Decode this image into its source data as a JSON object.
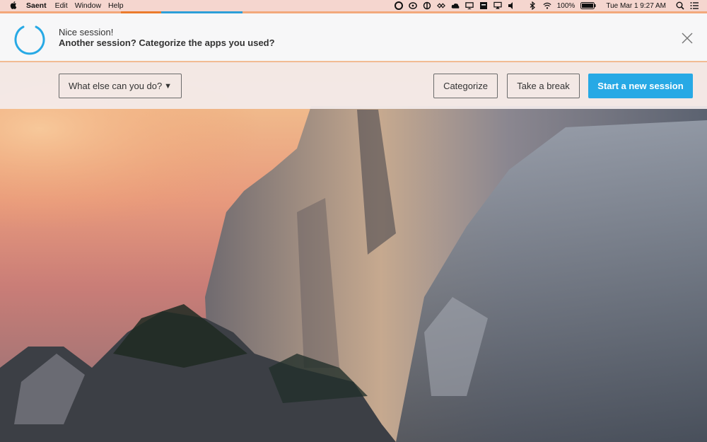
{
  "menubar": {
    "app_name": "Saent",
    "menus": [
      "Edit",
      "Window",
      "Help"
    ],
    "battery": "100%",
    "datetime": "Tue Mar 1  9:27 AM"
  },
  "stripe_colors": [
    "#f3a77a",
    "#eb7b2c",
    "#2d9fd8"
  ],
  "banner": {
    "line1": "Nice session!",
    "line2": "Another session? Categorize the apps you used?"
  },
  "actions": {
    "dropdown_label": "What else can you do?",
    "categorize": "Categorize",
    "take_break": "Take a break",
    "start_session": "Start a new session"
  },
  "colors": {
    "accent": "#27a9e5",
    "ring": "#27a9e5"
  }
}
